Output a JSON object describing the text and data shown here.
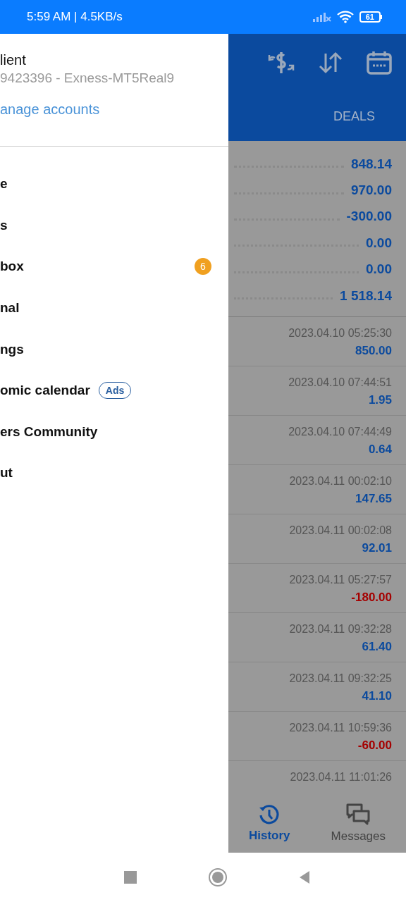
{
  "status_bar": {
    "time": "5:59 AM | 4.5KB/s",
    "battery": "61"
  },
  "drawer": {
    "account_name": "lient",
    "account_server": "9423396 - Exness-MT5Real9",
    "manage_link": "anage accounts",
    "items": [
      {
        "label": "e"
      },
      {
        "label": "s"
      },
      {
        "label": "box",
        "badge": "6"
      },
      {
        "label": "nal"
      },
      {
        "label": "ngs"
      },
      {
        "label": "omic calendar",
        "tag": "Ads"
      },
      {
        "label": "ers Community"
      },
      {
        "label": "ut"
      }
    ]
  },
  "history": {
    "tabs": [
      {
        "label": "DEALS"
      }
    ],
    "summary": [
      {
        "value": "848.14"
      },
      {
        "value": "970.00"
      },
      {
        "value": "-300.00"
      },
      {
        "value": "0.00"
      },
      {
        "value": "0.00"
      },
      {
        "value": "1 518.14"
      }
    ],
    "deals": [
      {
        "time": "2023.04.10 05:25:30",
        "amount": "850.00",
        "color": "#0b4a9e"
      },
      {
        "time": "2023.04.10 07:44:51",
        "amount": "1.95",
        "color": "#0b4a9e"
      },
      {
        "time": "2023.04.10 07:44:49",
        "amount": "0.64",
        "color": "#0b4a9e"
      },
      {
        "time": "2023.04.11 00:02:10",
        "amount": "147.65",
        "color": "#0b4a9e"
      },
      {
        "time": "2023.04.11 00:02:08",
        "amount": "92.01",
        "color": "#0b4a9e"
      },
      {
        "time": "2023.04.11 05:27:57",
        "amount": "-180.00",
        "color": "#a50000"
      },
      {
        "time": "2023.04.11 09:32:28",
        "amount": "61.40",
        "color": "#0b4a9e"
      },
      {
        "time": "2023.04.11 09:32:25",
        "amount": "41.10",
        "color": "#0b4a9e"
      },
      {
        "time": "2023.04.11 10:59:36",
        "amount": "-60.00",
        "color": "#a50000"
      },
      {
        "time": "2023.04.11 11:01:26"
      }
    ],
    "bottom_tabs": [
      {
        "label": "History",
        "selected": true
      },
      {
        "label": "Messages",
        "selected": false
      }
    ]
  }
}
